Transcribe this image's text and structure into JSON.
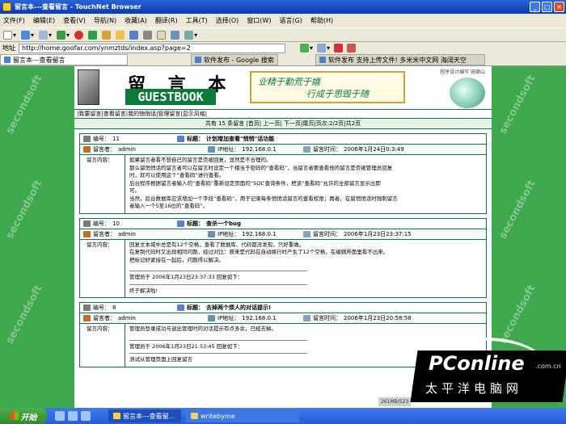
{
  "window": {
    "title": "留言本---查看留言 - TouchNet Browser"
  },
  "menu": [
    "文件(F)",
    "编辑(E)",
    "查看(V)",
    "导航(N)",
    "收藏(A)",
    "翻译(R)",
    "工具(T)",
    "选择(O)",
    "窗口(W)",
    "语言(G)",
    "帮助(H)"
  ],
  "address": {
    "label": "地址",
    "url": "http://home.goofar.com/ynmztds/index.asp?page=2"
  },
  "tabs": [
    {
      "label": "留言本---查看留言"
    },
    {
      "label": "软件发布 - Google 搜索"
    },
    {
      "label": "软件发布  支持上传文件!  多米米中文网 海阔天空"
    }
  ],
  "page": {
    "title": "留 言 本",
    "subtitle": "GUESTBOOK",
    "motto1": "业精于勤荒于嬉",
    "motto2": "行成于思毁于随",
    "designer": "程序设计编写 田德山",
    "nav": "|我要留言|查看留言|我的悄悄话|管理留言|显示风格|",
    "pager": "共有 15 条留言 |首页| 上一页| 下一页|尾页|页次:2/2页|共2页"
  },
  "labels": {
    "id": "编号：",
    "subject": "标题：",
    "author": "留言者：",
    "ip": "IP地址：",
    "time": "留言时间：",
    "content": "留言内容："
  },
  "messages": [
    {
      "id": "11",
      "subject": "计划增加查看\"悄悄\"话功能",
      "author": "admin",
      "ip": "192.168.0.1",
      "time": "2006年1月24日0:3:49",
      "lines": [
        "如果留言者看不想自己的留言是否被回复，显然是不合理的。",
        "那么留悄悄话的留言者可以在留言时设定一个相当于密码的“查看码”，当留言者要查看他的留言是否被管理员回复",
        "时，就可以使用这个“查看码”进行查看。",
        "后台程序根据留言者输入的“查看码”重新设定页面的“SQL”查询条件，把该“查看码”允许的全部留言显示出即",
        "可。",
        "当然，后台数据库应该增加一个字段“查看码”，用于记录每条悄悄话留言的查看权限；再者，在留悄悄话时强制留言",
        "者输入一个5至16位的“查看码”。"
      ],
      "reply": null
    },
    {
      "id": "10",
      "subject": "查杀一个bug",
      "author": "admin",
      "ip": "192.168.0.1",
      "time": "2006年1月23日23:37:15",
      "lines": [
        "回复文本域中总是有12个空格，查看了数据库、代码都没发现，只好重做。",
        "在复制代码时又出现相同问题，经过对比：原来是代码在自动换行时产生了12个空格，在编辑界面里看不出来。",
        "把标记好紧接在一起后，问题得以解决。"
      ],
      "reply": {
        "head": "管理员于 2006年1月23日23:37:33 回复如下：",
        "text": "终于解决啦!"
      }
    },
    {
      "id": "8",
      "subject": "去掉两个烦人的对话提示!",
      "author": "admin",
      "ip": "192.168.0.1",
      "time": "2006年1月23日20:58:58",
      "lines": [
        "管理员登录成功与退出管理时的对话提示有点多余，已经去掉。"
      ],
      "reply": {
        "head": "管理员于 2006年1月23日21:53:45 回复如下：",
        "text": "测试从管理页面上回复留言"
      }
    }
  ],
  "watermark": "secondsoft",
  "taskbar": {
    "start": "开始",
    "task1": "留言本---查看留...",
    "task2": "writebyme"
  },
  "status": {
    "memory": "261MB/523"
  },
  "brand": {
    "logo": "PConline",
    "suffix": ".com.cn",
    "cn": "太平洋电脑网"
  }
}
